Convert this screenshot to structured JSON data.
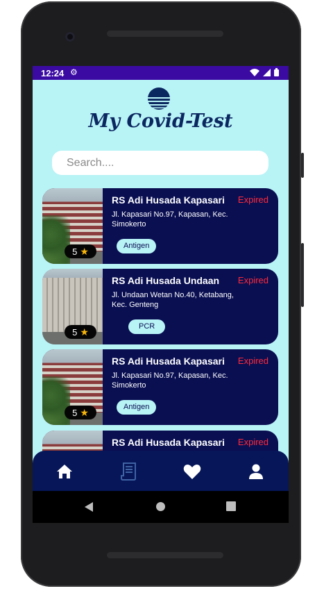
{
  "status_bar": {
    "time": "12:24"
  },
  "app": {
    "title": "My Covid-Test"
  },
  "search": {
    "placeholder": "Search...."
  },
  "cards": [
    {
      "name": "RS Adi Husada Kapasari",
      "status": "Expired",
      "address": "Jl. Kapasari No.97, Kapasan, Kec. Simokerto",
      "tag": "Antigen",
      "rating": "5"
    },
    {
      "name": "RS Adi Husada Undaan",
      "status": "Expired",
      "address": "Jl. Undaan Wetan No.40, Ketabang, Kec. Genteng",
      "tag": "PCR",
      "rating": "5"
    },
    {
      "name": "RS Adi Husada Kapasari",
      "status": "Expired",
      "address": "Jl. Kapasari No.97, Kapasan, Kec. Simokerto",
      "tag": "Antigen",
      "rating": "5"
    },
    {
      "name": "RS Adi Husada Kapasari",
      "status": "Expired"
    }
  ],
  "nav": [
    {
      "icon": "home-icon",
      "active": true
    },
    {
      "icon": "receipt-icon",
      "active": false
    },
    {
      "icon": "heart-icon",
      "active": true
    },
    {
      "icon": "profile-icon",
      "active": true
    }
  ],
  "colors": {
    "background": "#b8f3f6",
    "card": "#0a0f52",
    "status_bar": "#3b0aa3",
    "expired": "#ff2a3a",
    "nav_bar": "#061658"
  }
}
